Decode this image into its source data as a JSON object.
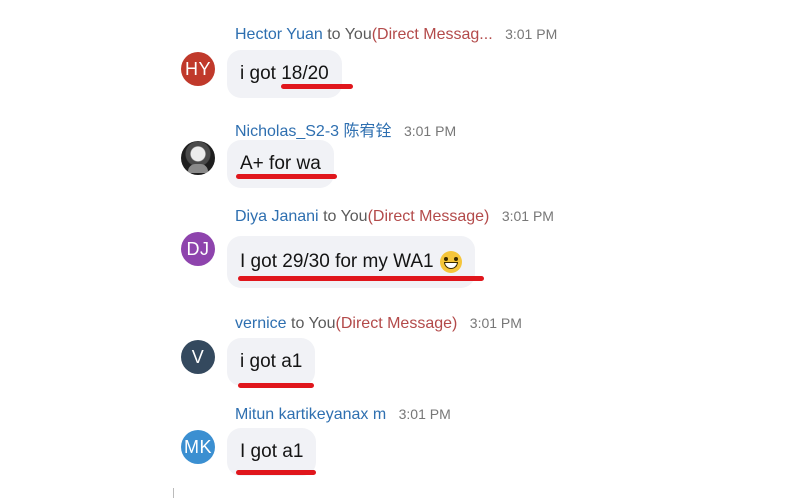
{
  "messages": [
    {
      "avatar_initials": "HY",
      "avatar_color": "#c0392b",
      "sender": "Hector Yuan",
      "to": "to You",
      "tag": "(Direct Messag...",
      "time": "3:01 PM",
      "text": "i got 18/20"
    },
    {
      "avatar_icon": "user-photo",
      "sender": "Nicholas_S2-3 陈宥铨",
      "time": "3:01 PM",
      "text": "A+ for wa"
    },
    {
      "avatar_initials": "DJ",
      "avatar_color": "#8e44ad",
      "sender": "Diya Janani",
      "to": "to You",
      "tag": "(Direct Message)",
      "time": "3:01 PM",
      "text": "I got 29/30 for my WA1",
      "emoji": "grinning-face"
    },
    {
      "avatar_initials": "V",
      "avatar_color": "#34495e",
      "sender": "vernice",
      "to": "to You",
      "tag": "(Direct Message)",
      "time": "3:01 PM",
      "text": "i got a1"
    },
    {
      "avatar_initials": "MK",
      "avatar_color": "#3b8fd1",
      "sender": "Mitun kartikeyanax m",
      "time": "3:01 PM",
      "text": "I got a1"
    }
  ],
  "annotation_color": "#e0161c"
}
